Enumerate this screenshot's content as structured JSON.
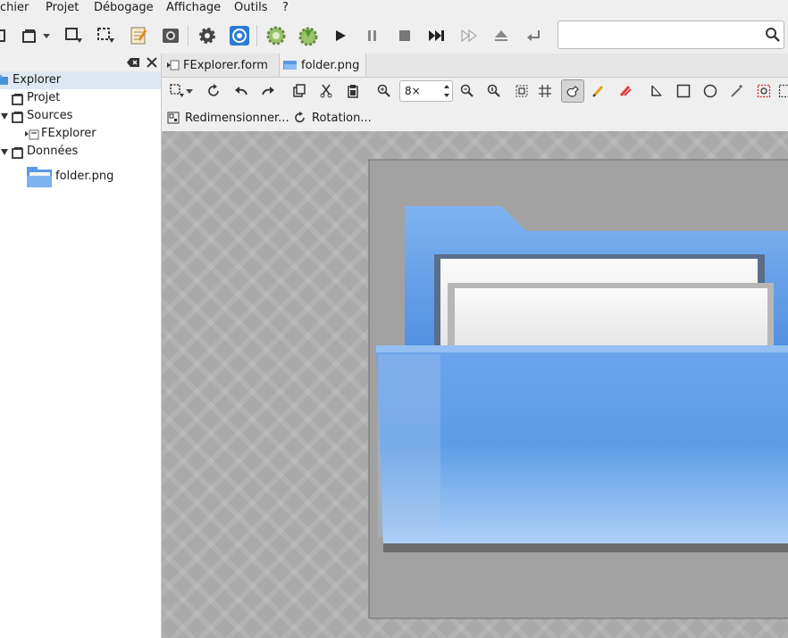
{
  "menu": {
    "items": [
      "chier",
      "Projet",
      "Débogage",
      "Affichage",
      "Outils",
      "?"
    ]
  },
  "search": {
    "value": "",
    "placeholder": ""
  },
  "explorer": {
    "root": "Explorer",
    "items": [
      "Projet",
      "Sources",
      "FExplorer",
      "Données",
      "folder.png"
    ]
  },
  "tabs": [
    "FExplorer.form",
    "folder.png"
  ],
  "image_toolbar": {
    "zoom": "8×"
  },
  "actions": {
    "resize": "Redimensionner...",
    "rotate": "Rotation..."
  },
  "colors": {
    "accent": "#3daee9",
    "folder_blue": "#5b98e6",
    "canvas_bg": "#a9a9a9",
    "selection": "#dfe8f2"
  },
  "icons": {
    "toolbar": [
      "new-project-icon",
      "open-project-icon",
      "save-icon",
      "save-all-icon",
      "properties-icon",
      "screenshot-icon",
      "settings-icon",
      "help-icon",
      "compile-icon",
      "make-executable-icon",
      "run-icon",
      "pause-icon",
      "stop-icon",
      "step-icon",
      "forward-icon",
      "eject-icon",
      "return-icon",
      "search-icon"
    ]
  }
}
